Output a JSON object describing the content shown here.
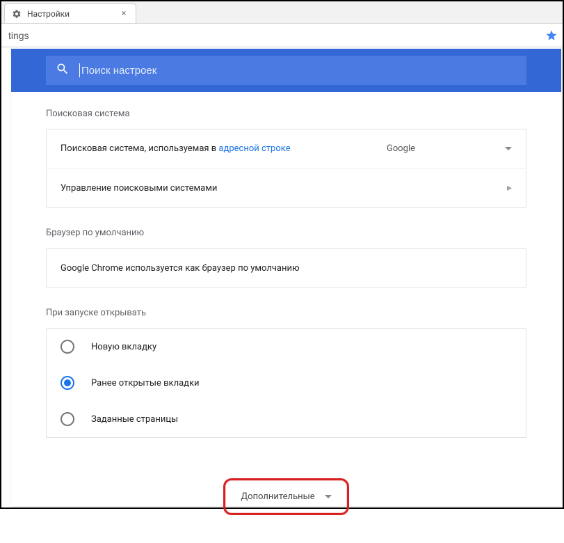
{
  "tab": {
    "title": "Настройки"
  },
  "address_bar": {
    "value": "tings"
  },
  "search": {
    "placeholder": "Поиск настроек"
  },
  "sections": {
    "search_engine": {
      "title": "Поисковая система",
      "row1_prefix": "Поисковая система, используемая в ",
      "row1_link": "адресной строке",
      "dropdown_value": "Google",
      "row2_label": "Управление поисковыми системами"
    },
    "default_browser": {
      "title": "Браузер по умолчанию",
      "status": "Google Chrome используется как браузер по умолчанию"
    },
    "on_startup": {
      "title": "При запуске открывать",
      "options": [
        {
          "label": "Новую вкладку",
          "selected": false
        },
        {
          "label": "Ранее открытые вкладки",
          "selected": true
        },
        {
          "label": "Заданные страницы",
          "selected": false
        }
      ]
    }
  },
  "advanced_label": "Дополнительные"
}
